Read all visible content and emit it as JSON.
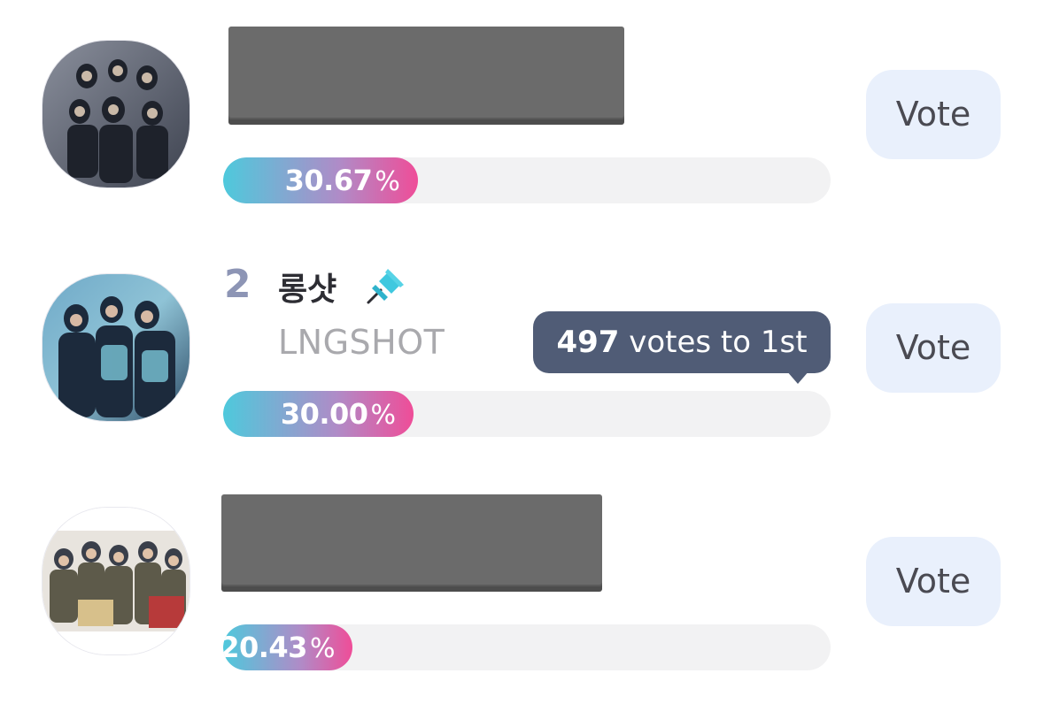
{
  "entries": [
    {
      "percent_value": 30.67,
      "percent_text": "30.67",
      "percent_sign": "%",
      "vote_label": "Vote"
    },
    {
      "rank": "2",
      "name_ko": "롱샷",
      "name_en": "LNGSHOT",
      "pin_icon": "pushpin-icon",
      "tooltip_count": "497",
      "tooltip_text": "votes to 1st",
      "percent_value": 30.0,
      "percent_text": "30.00",
      "percent_sign": "%",
      "vote_label": "Vote"
    },
    {
      "percent_value": 20.43,
      "percent_text": "20.43",
      "percent_sign": "%",
      "vote_label": "Vote"
    }
  ],
  "colors": {
    "bar_gradient_start": "#4ec9dc",
    "bar_gradient_mid": "#b08bc7",
    "bar_gradient_end": "#ef4d98",
    "vote_button_bg": "#e9f0fc",
    "tooltip_bg": "#505c76",
    "rank_color": "#8d95b5",
    "pin_color": "#3fc8df"
  }
}
